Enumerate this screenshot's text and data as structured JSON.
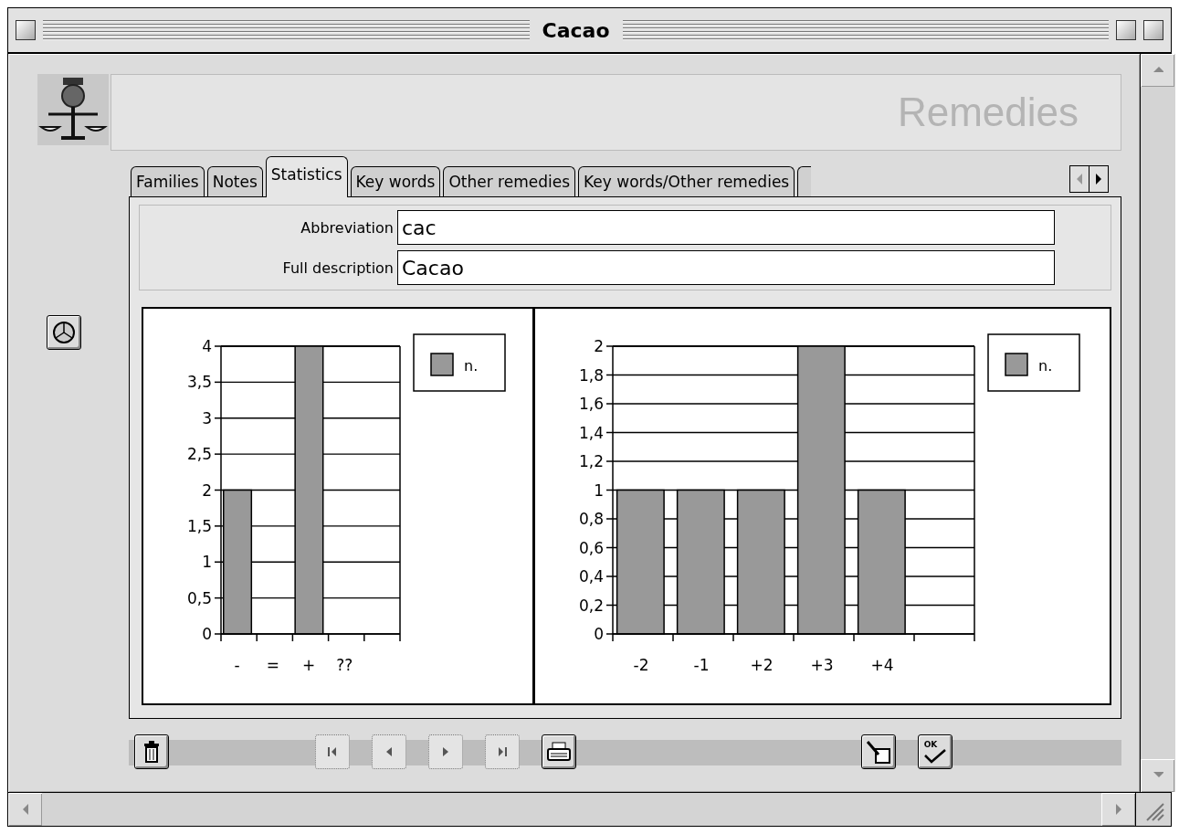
{
  "window": {
    "title": "Cacao"
  },
  "header": {
    "title": "Remedies"
  },
  "tabs": [
    {
      "label": "Families",
      "selected": false
    },
    {
      "label": "Notes",
      "selected": false
    },
    {
      "label": "Statistics",
      "selected": true
    },
    {
      "label": "Key words",
      "selected": false
    },
    {
      "label": "Other remedies",
      "selected": false
    },
    {
      "label": "Key words/Other remedies",
      "selected": false
    }
  ],
  "tab_scroll": {
    "previous_disabled": true,
    "next_disabled": false
  },
  "fields": [
    {
      "label": "Abbreviation",
      "value": "cac"
    },
    {
      "label": "Full description",
      "value": "Cacao"
    }
  ],
  "charts": [
    {
      "chart_data": {
        "type": "bar",
        "categories": [
          "-",
          "=",
          "+",
          "??"
        ],
        "ylim": [
          0,
          4
        ],
        "grid": true,
        "series": [
          {
            "name": "n.",
            "color": "#999999",
            "values": [
              2,
              0,
              4,
              0
            ]
          }
        ],
        "yticks": [
          {
            "value": 0,
            "label": "0"
          },
          {
            "value": 0.5,
            "label": "0,5"
          },
          {
            "value": 1,
            "label": "1"
          },
          {
            "value": 1.5,
            "label": "1,5"
          },
          {
            "value": 2,
            "label": "2"
          },
          {
            "value": 2.5,
            "label": "2,5"
          },
          {
            "value": 3,
            "label": "3"
          },
          {
            "value": 3.5,
            "label": "3,5"
          },
          {
            "value": 4,
            "label": "4"
          }
        ]
      }
    },
    {
      "chart_data": {
        "type": "bar",
        "categories": [
          "-2",
          "-1",
          "+2",
          "+3",
          "+4"
        ],
        "ylim": [
          0,
          2
        ],
        "grid": true,
        "series": [
          {
            "name": "n.",
            "color": "#999999",
            "values": [
              1,
              1,
              1,
              2,
              1
            ]
          }
        ],
        "yticks": [
          {
            "value": 0,
            "label": "0"
          },
          {
            "value": 0.2,
            "label": "0,2"
          },
          {
            "value": 0.4,
            "label": "0,4"
          },
          {
            "value": 0.6,
            "label": "0,6"
          },
          {
            "value": 0.8,
            "label": "0,8"
          },
          {
            "value": 1,
            "label": "1"
          },
          {
            "value": 1.2,
            "label": "1,2"
          },
          {
            "value": 1.4,
            "label": "1,4"
          },
          {
            "value": 1.6,
            "label": "1,6"
          },
          {
            "value": 1.8,
            "label": "1,8"
          },
          {
            "value": 2,
            "label": "2"
          }
        ]
      }
    }
  ],
  "toolbar": {
    "buttons": [
      {
        "kind": "delete",
        "disabled": false
      },
      {
        "kind": "first",
        "disabled": true
      },
      {
        "kind": "previous",
        "disabled": true
      },
      {
        "kind": "next",
        "disabled": true
      },
      {
        "kind": "last",
        "disabled": true
      },
      {
        "kind": "print",
        "disabled": false
      },
      {
        "kind": "edit",
        "disabled": false
      },
      {
        "kind": "ok",
        "label": "OK",
        "disabled": false
      }
    ]
  }
}
